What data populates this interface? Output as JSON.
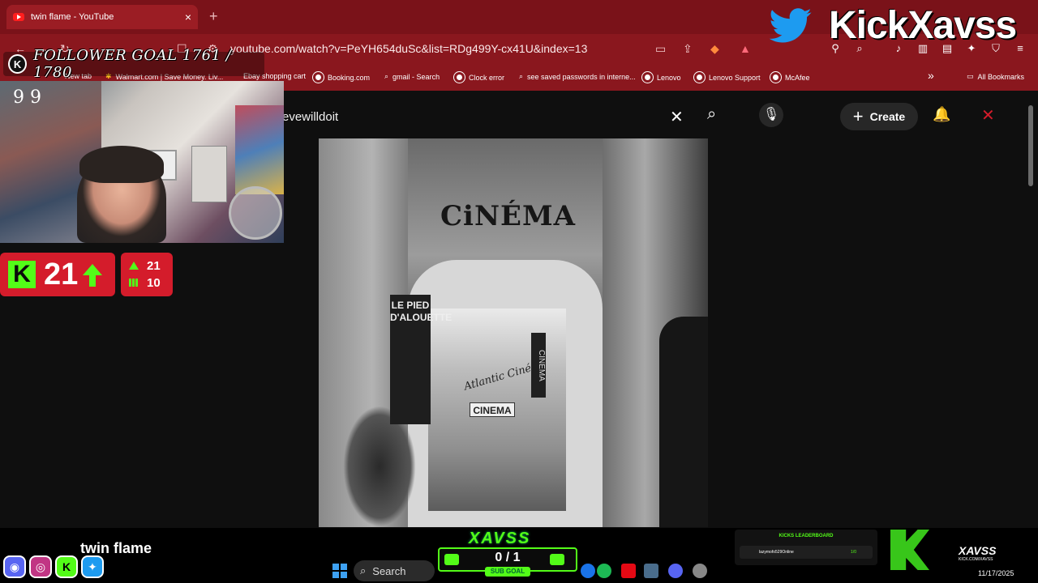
{
  "browser": {
    "tab_title": "twin flame - YouTube",
    "tab_close": "×",
    "new_tab": "+",
    "url": "youtube.com/watch?v=PeYH654duSc&list=RDg499Y-cx41U&index=13",
    "bookmarks": [
      "New tab",
      "Walmart.com | Save Money. Liv...",
      "Ebay shopping cart",
      "Booking.com",
      "gmail - Search",
      "Clock error",
      "see saved passwords in interne...",
      "Lenovo",
      "Lenovo Support",
      "McAfee"
    ],
    "all_bookmarks": "All Bookmarks",
    "more": "»"
  },
  "youtube": {
    "search_value": "evewilldoit",
    "create_label": "Create",
    "clear_icon": "close-icon",
    "search_icon": "search-icon",
    "mic_icon": "mic-icon",
    "bell_icon": "bell-icon"
  },
  "video": {
    "sign_main": "CiNÉMA",
    "sign_pied": "LE PIED D'ALOUETTE",
    "sign_cinema_small": "CINEMA",
    "sign_vertical": "CINEMA",
    "sign_atlantic": "Atlantic Ciné"
  },
  "stream_overlay": {
    "follower_goal": "FOLLOWER GOAL 1761 / 1780",
    "kick_letter": "K",
    "kick_count": "21",
    "stat_up": "21",
    "stat_bars": "10",
    "brand": "KickXavss",
    "song_name": "twin flame",
    "sub_goal_brand": "XAVSS",
    "sub_goal_value": "0 / 1",
    "sub_goal_label": "SUB GOAL",
    "leaderboard_title": "KICKS LEADERBOARD",
    "leaderboard_user": "lazymofo529Online",
    "leaderboard_amount": "1/0",
    "badge_name": "XAVSS",
    "badge_sub": "KICK.COM/XAVSS",
    "webcam_wall_text": "9 9"
  },
  "taskbar": {
    "search_label": "Search",
    "date": "11/17/2025"
  },
  "colors": {
    "browser_red": "#8a171e",
    "kick_green": "#53fc18",
    "overlay_red": "#d41c2b",
    "twitter_blue": "#1d9bf0"
  }
}
